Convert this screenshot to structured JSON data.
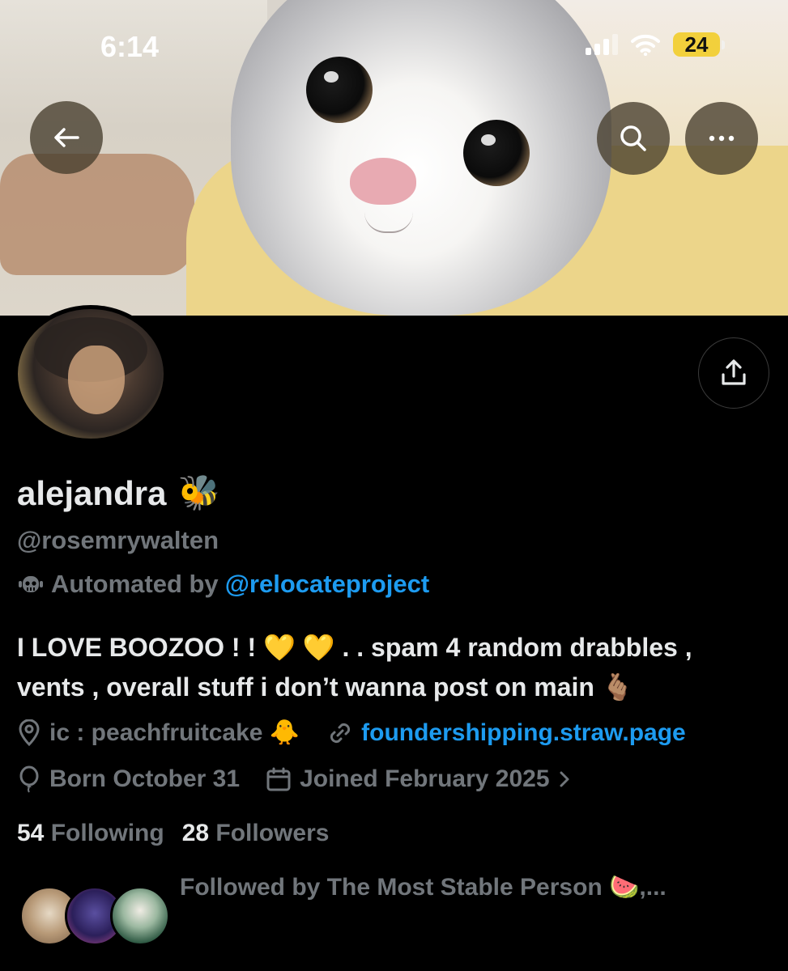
{
  "status_bar": {
    "time": "6:14",
    "battery": "24"
  },
  "header": {
    "back_icon": "arrow-left-icon",
    "search_icon": "search-icon",
    "more_icon": "more-horizontal-icon",
    "share_icon": "share-upload-icon"
  },
  "profile": {
    "display_name": "alejandra",
    "name_emoji": "🐝",
    "handle": "@rosemrywalten",
    "automated_prefix": "Automated by",
    "automated_account": "@relocateproject",
    "bio_line1": "I LOVE BOOZOO ! ! 💛 💛 . . spam 4 random drabbles ,",
    "bio_line2": "vents , overall stuff i don’t wanna post on main 🫰🏽",
    "location": "ic : peachfruitcake 🐥",
    "website": "foundershipping.straw.page",
    "birthday": "Born October 31",
    "joined": "Joined February 2025"
  },
  "stats": {
    "following_count": "54",
    "following_label": "Following",
    "followers_count": "28",
    "followers_label": "Followers"
  },
  "followed_by": {
    "text": "Followed by The Most Stable Person 🍉,..."
  },
  "colors": {
    "link": "#1d9bf0",
    "muted": "#71767b",
    "text": "#e7e9ea",
    "background": "#000000"
  }
}
